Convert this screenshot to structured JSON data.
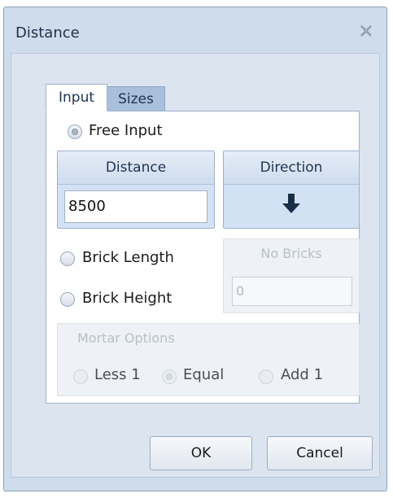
{
  "window": {
    "title": "Distance",
    "close_icon": "close-x-icon"
  },
  "tabs": [
    {
      "label": "Input",
      "active": true
    },
    {
      "label": "Sizes",
      "active": false
    }
  ],
  "free_input": {
    "label": "Free Input",
    "checked": true
  },
  "distance": {
    "header": "Distance",
    "value": "8500"
  },
  "direction": {
    "header": "Direction",
    "icon": "arrow-down-icon"
  },
  "brick_length": {
    "label": "Brick Length",
    "checked": false
  },
  "brick_height": {
    "label": "Brick Height",
    "checked": false
  },
  "no_bricks": {
    "header": "No Bricks",
    "value": "0",
    "enabled": false
  },
  "mortar": {
    "header": "Mortar Options",
    "enabled": false,
    "options": [
      {
        "label": "Less 1",
        "checked": false
      },
      {
        "label": "Equal",
        "checked": true
      },
      {
        "label": "Add 1",
        "checked": false
      }
    ]
  },
  "buttons": {
    "ok": "OK",
    "cancel": "Cancel"
  },
  "colors": {
    "window_bg": "#cfdcec",
    "group_blue": "#d3e1f4",
    "arrow": "#1a2e4a",
    "disabled_text": "#a7afb9"
  }
}
